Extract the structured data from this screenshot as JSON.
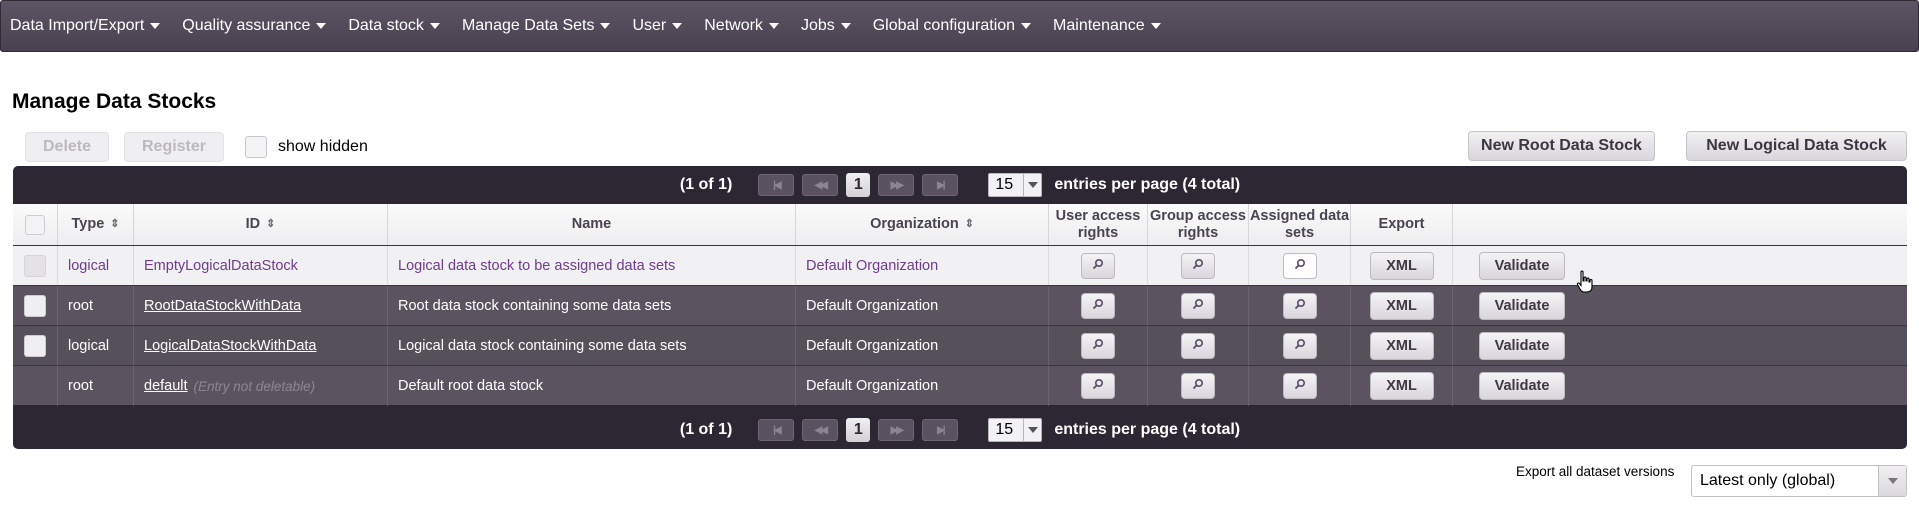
{
  "menu": [
    {
      "label": "Data Import/Export"
    },
    {
      "label": "Quality assurance"
    },
    {
      "label": "Data stock"
    },
    {
      "label": "Manage Data Sets"
    },
    {
      "label": "User"
    },
    {
      "label": "Network"
    },
    {
      "label": "Jobs"
    },
    {
      "label": "Global configuration"
    },
    {
      "label": "Maintenance"
    }
  ],
  "page": {
    "title": "Manage Data Stocks"
  },
  "toolbar": {
    "delete_label": "Delete",
    "register_label": "Register",
    "show_hidden_label": "show hidden",
    "new_root_label": "New Root Data Stock",
    "new_logical_label": "New Logical Data Stock"
  },
  "pager": {
    "page_info": "(1 of 1)",
    "current_page": "1",
    "per_page": "15",
    "summary": "entries per page (4 total)"
  },
  "table": {
    "columns": {
      "type": "Type",
      "id": "ID",
      "name": "Name",
      "organization": "Organization",
      "user_access": "User access rights",
      "group_access": "Group access rights",
      "assigned": "Assigned data sets",
      "export": "Export"
    },
    "rows": [
      {
        "type": "logical",
        "id": "EmptyLogicalDataStock",
        "note": "",
        "name": "Logical data stock to be assigned data sets",
        "organization": "Default Organization",
        "export_label": "XML",
        "validate_label": "Validate"
      },
      {
        "type": "root",
        "id": "RootDataStockWithData",
        "note": "",
        "name": "Root data stock containing some data sets",
        "organization": "Default Organization",
        "export_label": "XML",
        "validate_label": "Validate"
      },
      {
        "type": "logical",
        "id": "LogicalDataStockWithData",
        "note": "",
        "name": "Logical data stock containing some data sets",
        "organization": "Default Organization",
        "export_label": "XML",
        "validate_label": "Validate"
      },
      {
        "type": "root",
        "id": "default",
        "note": "(Entry not deletable)",
        "name": "Default root data stock",
        "organization": "Default Organization",
        "export_label": "XML",
        "validate_label": "Validate"
      }
    ]
  },
  "export_all": {
    "label": "Export all dataset versions",
    "selected": "Latest only (global)"
  },
  "icons": {
    "menu_caret": "caret-down-icon",
    "sort": "sort-icon",
    "magnifier": "magnifier-icon",
    "pager_first": "first-page-icon",
    "pager_prev": "prev-page-icon",
    "pager_next": "next-page-icon",
    "pager_last": "last-page-icon",
    "pointer": "hand-cursor-icon"
  }
}
